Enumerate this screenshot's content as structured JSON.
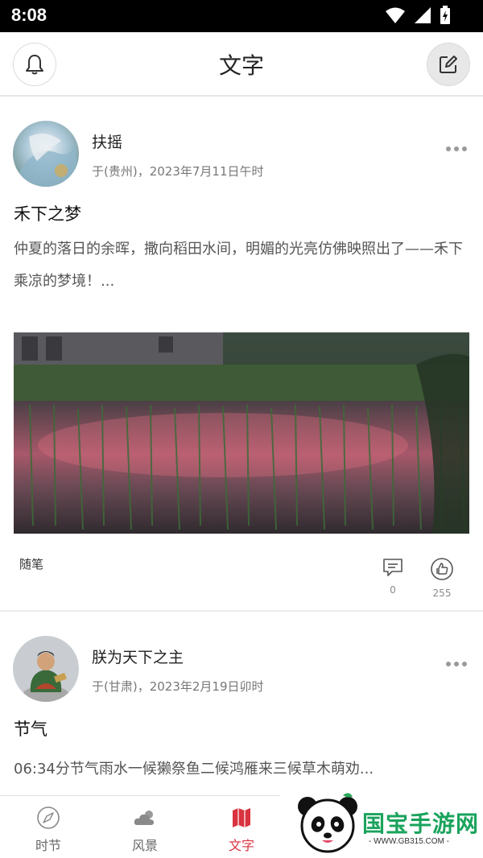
{
  "status_bar": {
    "time": "8:08"
  },
  "header": {
    "title": "文字"
  },
  "posts": [
    {
      "author": "扶摇",
      "meta": "于(贵州)，2023年7月11日午时",
      "title": "禾下之梦",
      "excerpt": "仲夏的落日的余晖，撒向稻田水间，明媚的光亮仿佛映照出了——禾下乘凉的梦境！...",
      "tag": "随笔",
      "comment_count": "0",
      "like_count": "255"
    },
    {
      "author": "朕为天下之主",
      "meta": "于(甘肃)，2023年2月19日卯时",
      "title": "节气",
      "excerpt": "06:34分节气雨水一候獭祭鱼二候鸿雁来三候草木萌劝..."
    }
  ],
  "tabs": [
    {
      "label": "时节",
      "icon": "compass-icon",
      "active": false
    },
    {
      "label": "风景",
      "icon": "cloud-icon",
      "active": false
    },
    {
      "label": "文字",
      "icon": "map-icon",
      "active": true
    }
  ],
  "watermark": {
    "brand": "国宝手游网",
    "url": "- WWW.GB315.COM -"
  },
  "colors": {
    "accent": "#d9333f",
    "watermark_green": "#1aa35c"
  }
}
